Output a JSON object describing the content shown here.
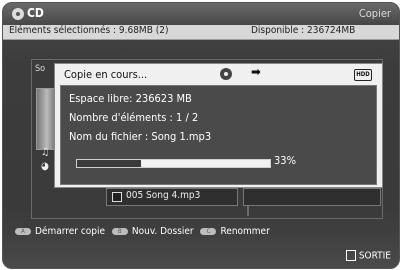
{
  "header": {
    "disc_title": "CD",
    "action": "Copier"
  },
  "infobar": {
    "selected": "Eléments sélectionnés : 9.68MB",
    "selected_count": "(2)",
    "available": "Disponible : 236724MB"
  },
  "background": {
    "panel_title_fragment": "So"
  },
  "dialog": {
    "title": "Copie en cours...",
    "hdd_label": "HDD",
    "free_space": "Espace libre: 236623 MB",
    "element_count": "Nombre d'éléments : 1 / 2",
    "file_name": "Nom du fichier : Song 1.mp3",
    "progress_percent": 33,
    "progress_text": "33%"
  },
  "list": {
    "visible_item": "005 Song 4.mp3"
  },
  "legend": [
    {
      "key": "A",
      "label": "Démarrer copie"
    },
    {
      "key": "B",
      "label": "Nouv. Dossier"
    },
    {
      "key": "C",
      "label": "Renommer"
    }
  ],
  "footer": {
    "exit_label": "SORTIE"
  },
  "icons": {
    "disc": "disc-icon",
    "arrow": "arrow-right-icon",
    "hdd": "hdd-icon",
    "music": "music-note-icon",
    "exit": "exit-icon"
  }
}
